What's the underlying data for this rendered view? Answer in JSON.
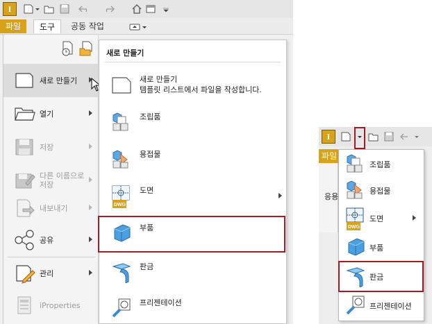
{
  "app": {
    "logo_letter": "I"
  },
  "menubar": {
    "tabs": [
      {
        "label": "파일",
        "state": "active"
      },
      {
        "label": "도구",
        "state": "selected"
      },
      {
        "label": "공동 작업",
        "state": "normal"
      }
    ]
  },
  "file_menu": {
    "items": [
      {
        "label": "새로 만들기",
        "icon": "new-document-icon",
        "has_submenu": true,
        "enabled": true,
        "hovered": true
      },
      {
        "label": "열기",
        "icon": "open-folder-icon",
        "has_submenu": true,
        "enabled": true
      },
      {
        "label": "저장",
        "icon": "save-icon",
        "has_submenu": true,
        "enabled": false
      },
      {
        "label": "다른 이름으로 저장",
        "icon": "save-as-icon",
        "has_submenu": true,
        "enabled": false
      },
      {
        "label": "내보내기",
        "icon": "export-icon",
        "has_submenu": true,
        "enabled": false
      },
      {
        "label": "공유",
        "icon": "share-icon",
        "has_submenu": true,
        "enabled": true
      },
      {
        "label": "관리",
        "icon": "manage-icon",
        "has_submenu": true,
        "enabled": true
      },
      {
        "label": "iProperties",
        "icon": "iproperties-icon",
        "has_submenu": false,
        "enabled": false
      }
    ]
  },
  "new_submenu": {
    "title": "새로 만들기",
    "items": [
      {
        "label": "새로 만들기",
        "description": "템플릿 리스트에서 파일을 작성합니다.",
        "icon": "blank-document-icon"
      },
      {
        "label": "조립품",
        "icon": "assembly-icon"
      },
      {
        "label": "용접물",
        "icon": "weldment-icon"
      },
      {
        "label": "도면",
        "icon": "drawing-dwg-icon",
        "has_submenu": true
      },
      {
        "label": "부품",
        "icon": "part-cube-icon",
        "highlighted": true
      },
      {
        "label": "판금",
        "icon": "sheet-metal-icon"
      },
      {
        "label": "프리젠테이션",
        "icon": "presentation-icon"
      }
    ]
  },
  "right_panel": {
    "tab_label": "파일",
    "side_text": "응용",
    "dropdown_items": [
      {
        "label": "조립품",
        "icon": "assembly-icon"
      },
      {
        "label": "용접물",
        "icon": "weldment-icon"
      },
      {
        "label": "도면",
        "icon": "drawing-dwg-icon",
        "has_submenu": true
      },
      {
        "label": "부품",
        "icon": "part-cube-icon"
      },
      {
        "label": "판금",
        "icon": "sheet-metal-icon",
        "highlighted": true
      },
      {
        "label": "프리젠테이션",
        "icon": "presentation-icon"
      }
    ]
  },
  "colors": {
    "accent": "#d9a21b",
    "highlight_border": "#a31a20",
    "part_blue": "#4a9fe0"
  }
}
